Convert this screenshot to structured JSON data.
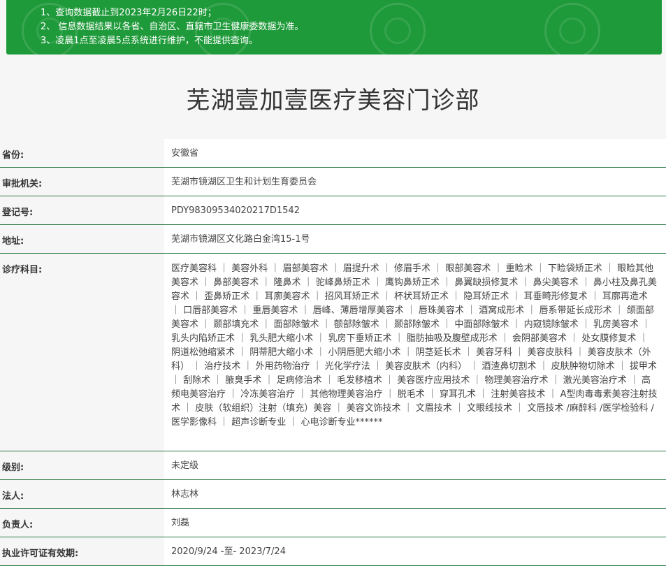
{
  "notice": {
    "items": [
      "1、查询数据截止到2023年2月26日22时；",
      "2、 信息数据结果以各省、自治区、直辖市卫生健康委数据为准。",
      "3、凌晨1点至凌晨5点系统进行维护，不能提供查询。"
    ]
  },
  "page": {
    "title": "芜湖壹加壹医疗美容门诊部"
  },
  "rows": [
    {
      "label": "省份:",
      "value": "安徽省"
    },
    {
      "label": "审批机关:",
      "value": "芜湖市镜湖区卫生和计划生育委员会"
    },
    {
      "label": "登记号:",
      "value": "PDY98309534020217D1542"
    },
    {
      "label": "地址:",
      "value": "芜湖市镜湖区文化路白金湾15-1号"
    },
    {
      "label": "诊疗科目:",
      "value": "医疗美容科 ｜ 美容外科 ｜ 眉部美容术 ｜ 眉提升术 ｜ 修眉手术 ｜ 眼部美容术 ｜ 重睑术 ｜ 下睑袋矫正术 ｜ 眼睑其他美容术 ｜ 鼻部美容术 ｜ 隆鼻术 ｜ 驼峰鼻矫正术 ｜ 鹰钩鼻矫正术 ｜ 鼻翼缺损修复术 ｜ 鼻尖美容术 ｜ 鼻小柱及鼻孔美容术 ｜ 歪鼻矫正术 ｜ 耳廓美容术 ｜ 招风耳矫正术 ｜ 杯状耳矫正术 ｜ 隐耳矫正术 ｜ 耳垂畸形修复术 ｜ 耳廓再造术 ｜ 口唇部美容术 ｜ 重唇美容术 ｜ 唇峰、薄唇增厚美容术 ｜ 唇珠美容术 ｜ 酒窝成形术 ｜ 唇系带延长成形术 ｜ 颌面部美容术 ｜ 颞部填充术 ｜ 面部除皱术 ｜ 额部除皱术 ｜ 颞部除皱术 ｜ 中面部除皱术 ｜ 内窥镜除皱术 ｜ 乳房美容术 ｜ 乳头内陷矫正术 ｜ 乳头肥大缩小术 ｜ 乳房下垂矫正术 ｜ 脂肪抽吸及腹壁成形术 ｜ 会阴部美容术 ｜ 处女膜修复术 ｜ 阴道松弛缩紧术 ｜ 阴蒂肥大缩小术 ｜ 小阴唇肥大缩小术 ｜ 阴茎延长术 ｜ 美容牙科 ｜ 美容皮肤科 ｜ 美容皮肤术（外科） ｜ 治疗技术 ｜ 外用药物治疗 ｜ 光化学疗法 ｜ 美容皮肤术（内科） ｜ 酒渣鼻切割术 ｜ 皮肤肿物切除术 ｜ 拔甲术 ｜ 刮除术 ｜ 腋臭手术 ｜ 足病修治术 ｜ 毛发移植术 ｜ 美容医疗应用技术 ｜ 物理美容治疗术 ｜ 激光美容治疗术 ｜ 高频电美容治疗 ｜ 冷冻美容治疗 ｜ 其他物理美容治疗 ｜ 脱毛术 ｜ 穿耳孔术 ｜ 注射美容技术 ｜ A型肉毒毒素美容注射技术 ｜ 皮肤（软组织）注射（填充）美容 ｜ 美容文饰技术 ｜ 文眉技术 ｜ 文眼线技术 ｜ 文唇技术 /麻醉科 /医学检验科 /医学影像科 ｜ 超声诊断专业 ｜ 心电诊断专业******"
    },
    {
      "label": "级别:",
      "value": "未定级"
    },
    {
      "label": "法人:",
      "value": "林志林"
    },
    {
      "label": "负责人:",
      "value": "刘磊"
    },
    {
      "label": "执业许可证有效期:",
      "value": "2020/9/24 -至- 2023/7/24"
    }
  ],
  "colors": {
    "notice_bg": "#1f9a3a",
    "row_border": "#2c7a44"
  },
  "icons": [
    "watermark-logo-icon"
  ]
}
